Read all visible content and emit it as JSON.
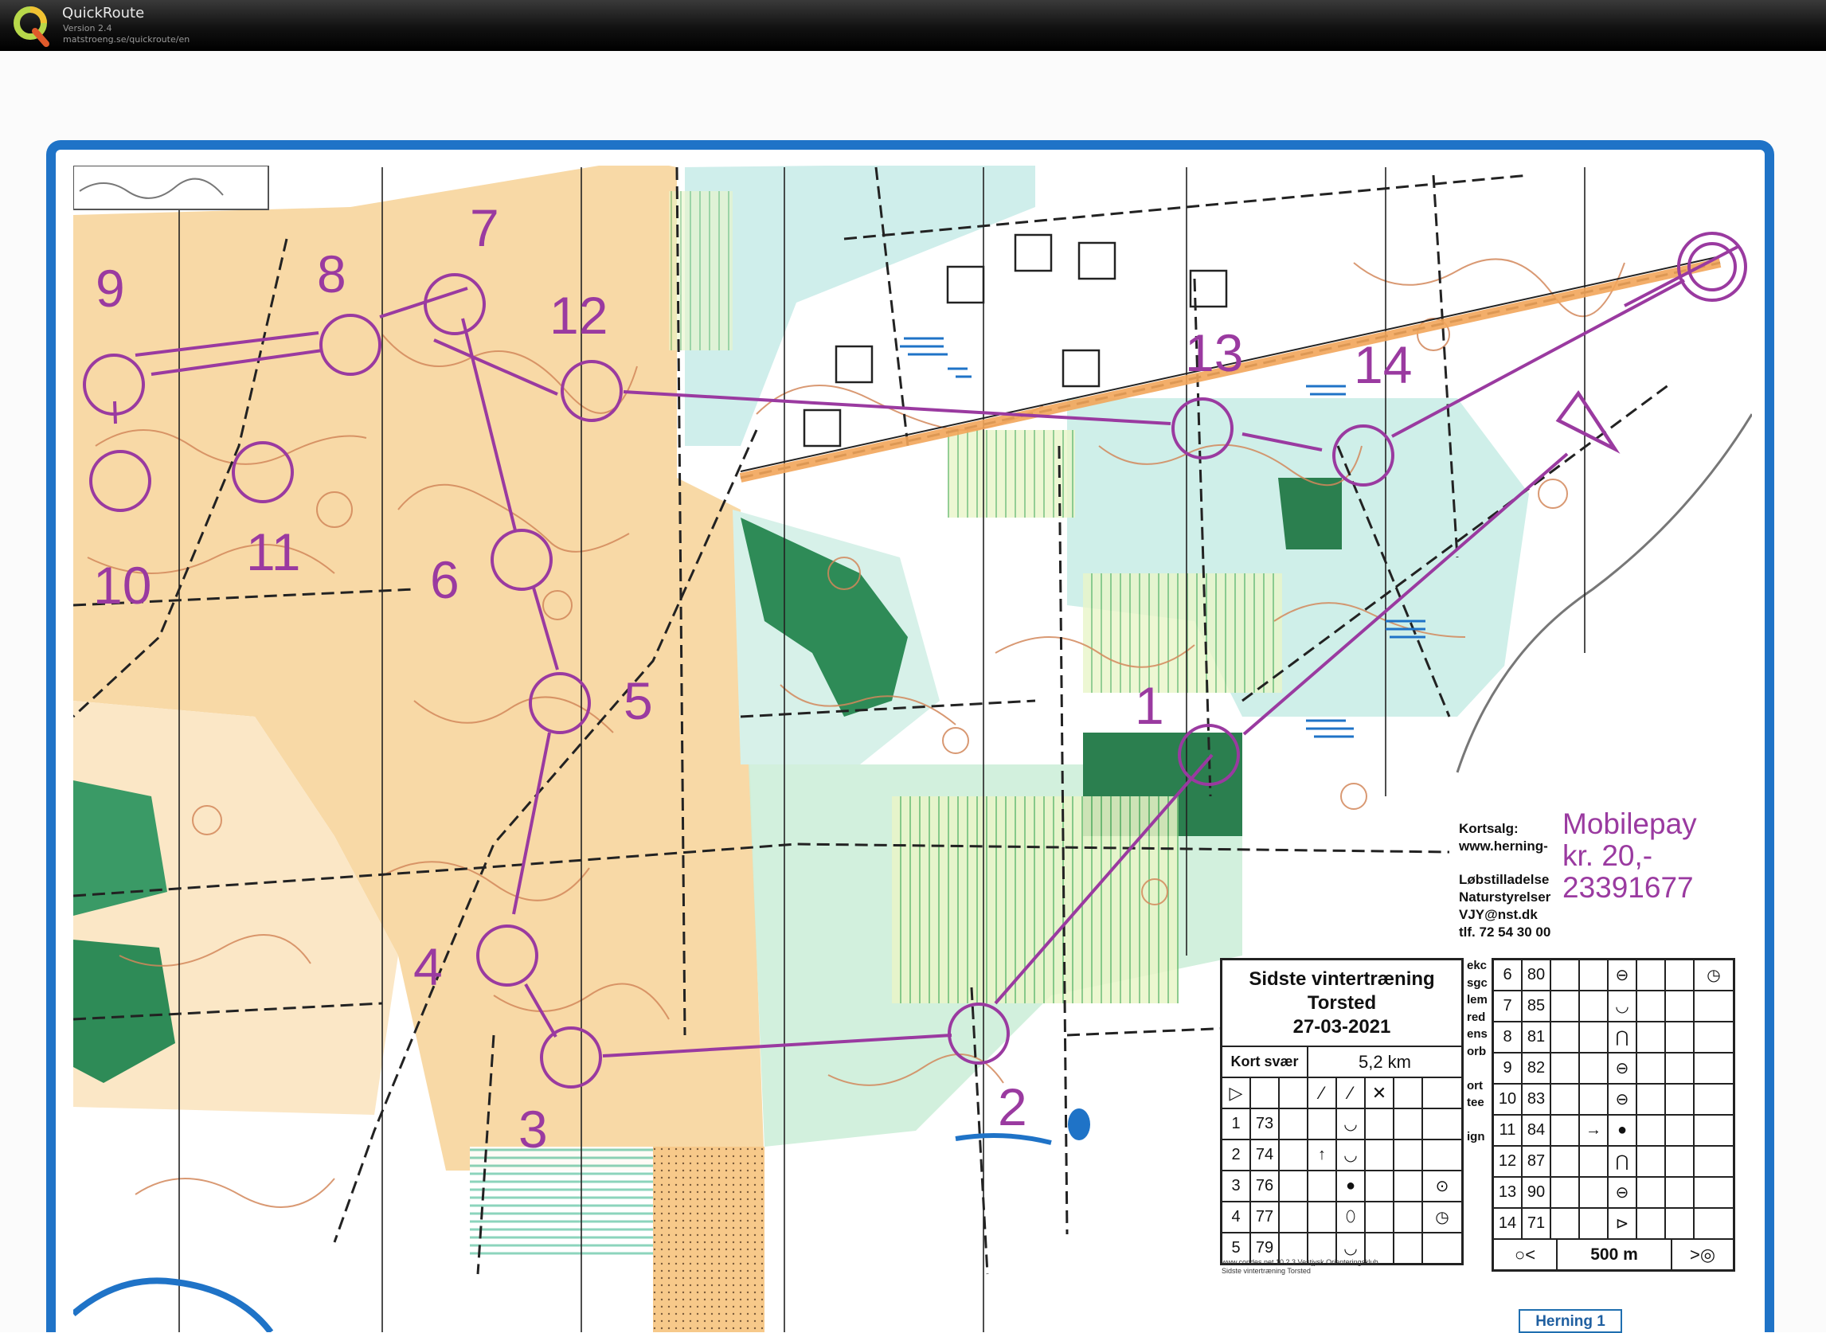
{
  "window": {
    "app_name": "QuickRoute",
    "version": "Version 2.4",
    "url": "matstroeng.se/quickroute/en"
  },
  "map": {
    "course_title_line1": "Sidste vintertræning",
    "course_title_line2": "Torsted",
    "date": "27-03-2021",
    "map_label": "Kort svær",
    "length": "5,2 km",
    "scale": "500 m",
    "map_name": "Herning 1",
    "footer_line1": "www.condes.net 10.2.3 Vestjysk Orienteringsklub",
    "footer_line2": "Sidste vintertræning Torsted",
    "colors": {
      "course": "#9a3aa0",
      "frame": "#1f73c7",
      "contour": "#d2875a",
      "open": "#f7d7a2",
      "forest": "#2e8b57"
    },
    "sales": {
      "line1": "Kortsalg:",
      "line2": "www.herning-",
      "line3": "Løbstilladelse",
      "line4": "Naturstyrelser",
      "line5": "VJY@nst.dk",
      "line6": "tlf. 72 54 30 00"
    },
    "mobilepay": {
      "line1": "Mobilepay",
      "line2": "kr. 20,-",
      "line3": "23391677"
    },
    "truncated_lines": [
      "ekc",
      "sgc",
      "lem",
      "red",
      "ens",
      "orb",
      "",
      "ort",
      "tee",
      "",
      "ign"
    ],
    "control_labels": [
      {
        "n": "1"
      },
      {
        "n": "2"
      },
      {
        "n": "3"
      },
      {
        "n": "4"
      },
      {
        "n": "5"
      },
      {
        "n": "6"
      },
      {
        "n": "7"
      },
      {
        "n": "8"
      },
      {
        "n": "9"
      },
      {
        "n": "10"
      },
      {
        "n": "11"
      },
      {
        "n": "12"
      },
      {
        "n": "13"
      },
      {
        "n": "14"
      }
    ]
  },
  "controls_left": [
    {
      "num": "1",
      "code": "73",
      "dir": "",
      "feature": "◡",
      "extra": ""
    },
    {
      "num": "2",
      "code": "74",
      "dir": "↑",
      "feature": "◡",
      "extra": ""
    },
    {
      "num": "3",
      "code": "76",
      "dir": "",
      "feature": "●",
      "extra": "⊙"
    },
    {
      "num": "4",
      "code": "77",
      "dir": "",
      "feature": "⬯",
      "extra": "◷"
    },
    {
      "num": "5",
      "code": "79",
      "dir": "",
      "feature": "◡",
      "extra": ""
    }
  ],
  "controls_right": [
    {
      "num": "6",
      "code": "80",
      "dir": "",
      "feature": "⊖",
      "extra": "◷"
    },
    {
      "num": "7",
      "code": "85",
      "dir": "",
      "feature": "◡",
      "extra": ""
    },
    {
      "num": "8",
      "code": "81",
      "dir": "",
      "feature": "⋂",
      "extra": ""
    },
    {
      "num": "9",
      "code": "82",
      "dir": "",
      "feature": "⊖",
      "extra": ""
    },
    {
      "num": "10",
      "code": "83",
      "dir": "",
      "feature": "⊖",
      "extra": ""
    },
    {
      "num": "11",
      "code": "84",
      "dir": "→",
      "feature": "●",
      "extra": ""
    },
    {
      "num": "12",
      "code": "87",
      "dir": "",
      "feature": "⋂",
      "extra": ""
    },
    {
      "num": "13",
      "code": "90",
      "dir": "",
      "feature": "⊖",
      "extra": ""
    },
    {
      "num": "14",
      "code": "71",
      "dir": "",
      "feature": "⊳",
      "extra": ""
    }
  ],
  "start_symbols": {
    "start": "▷",
    "s1": "⁄",
    "s2": "⁄",
    "s3": "✕"
  },
  "finish_symbols": {
    "left": "○<",
    "right": ">◎"
  }
}
